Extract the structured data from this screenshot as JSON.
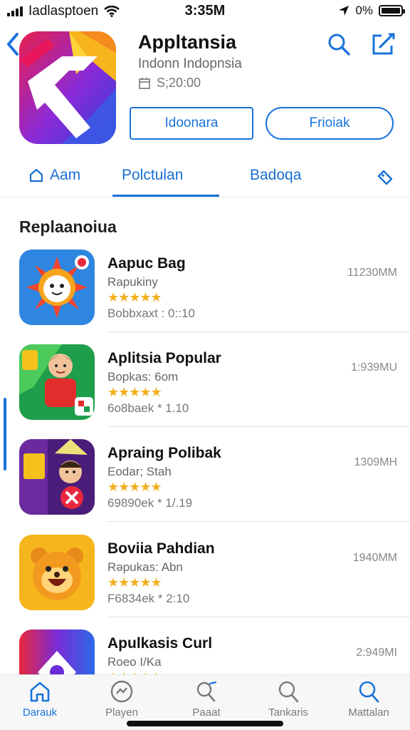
{
  "status_bar": {
    "carrier": "Iadlasptoen",
    "time": "3:35M",
    "battery": "0%"
  },
  "header": {
    "app_name": "Appltansia",
    "subtitle": "Indonn Indopnsia",
    "price": "S;20:00",
    "button_primary": "Idoonara",
    "button_secondary": "Frioiak"
  },
  "tabs": [
    {
      "label": "Aam"
    },
    {
      "label": "Polctulan"
    },
    {
      "label": "Badoqa"
    }
  ],
  "section": {
    "title": "Replaanoiua"
  },
  "apps": [
    {
      "title": "Aapuc Bag",
      "developer": "Rapukiny",
      "stars": "★★★★★",
      "meta": "Bobbxaxt : 0::10",
      "size": "11230MM"
    },
    {
      "title": "Aplitsia Popular",
      "developer": "Bopkas: 6om",
      "stars": "★★★★★",
      "meta": "6o8baek * 1.10",
      "size": "1:939MU"
    },
    {
      "title": "Apraing Polibak",
      "developer": "Eodar; Stah",
      "stars": "★★★★★",
      "meta": "69890ek * 1/.19",
      "size": "1309MH"
    },
    {
      "title": "Boviia Pahdian",
      "developer": "Rəpukas: Abn",
      "stars": "★★★★★",
      "meta": "F6834ek * 2:10",
      "size": "1940MM"
    },
    {
      "title": "Apulkasis Curl",
      "developer": "Roeo I/Ka",
      "stars": "★★★★★",
      "meta": "",
      "size": "2:949MI"
    }
  ],
  "bottom_nav": [
    {
      "label": "Darauk",
      "icon": "home-icon"
    },
    {
      "label": "Playen",
      "icon": "games-icon"
    },
    {
      "label": "Paaat",
      "icon": "people-search-icon"
    },
    {
      "label": "Tankaris",
      "icon": "search-icon"
    },
    {
      "label": "Mattalan",
      "icon": "search-icon"
    }
  ],
  "colors": {
    "accent": "#1a73d9",
    "star": "#f2b01e"
  }
}
